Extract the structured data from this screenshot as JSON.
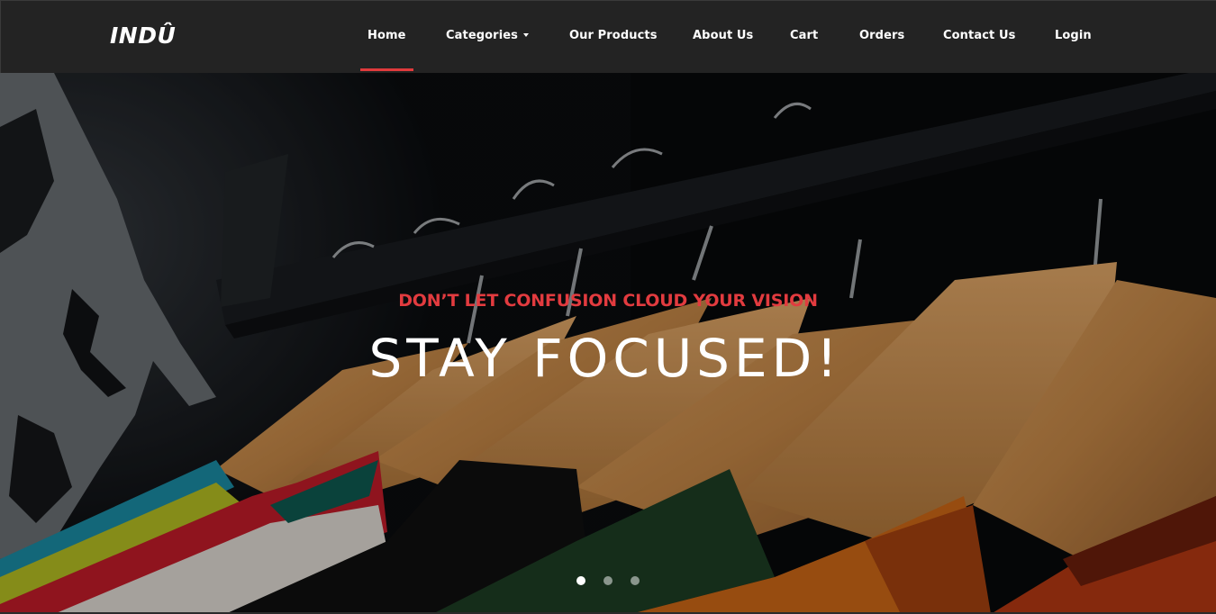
{
  "brand": {
    "name": "INDÛ"
  },
  "nav": {
    "items": [
      {
        "label": "Home",
        "active": true
      },
      {
        "label": "Categories",
        "dropdown": true
      },
      {
        "label": "Our Products"
      },
      {
        "label": "About Us"
      },
      {
        "label": "Cart"
      },
      {
        "label": "Orders"
      },
      {
        "label": "Contact Us"
      },
      {
        "label": "Login"
      }
    ]
  },
  "hero": {
    "eyebrow": "Don’t let confusion cloud your vision",
    "headline": "Stay Focused!",
    "slide_count": 3,
    "active_slide": 1
  },
  "colors": {
    "navbar_bg": "#232323",
    "accent": "#e23b3f",
    "text": "#ffffff"
  }
}
